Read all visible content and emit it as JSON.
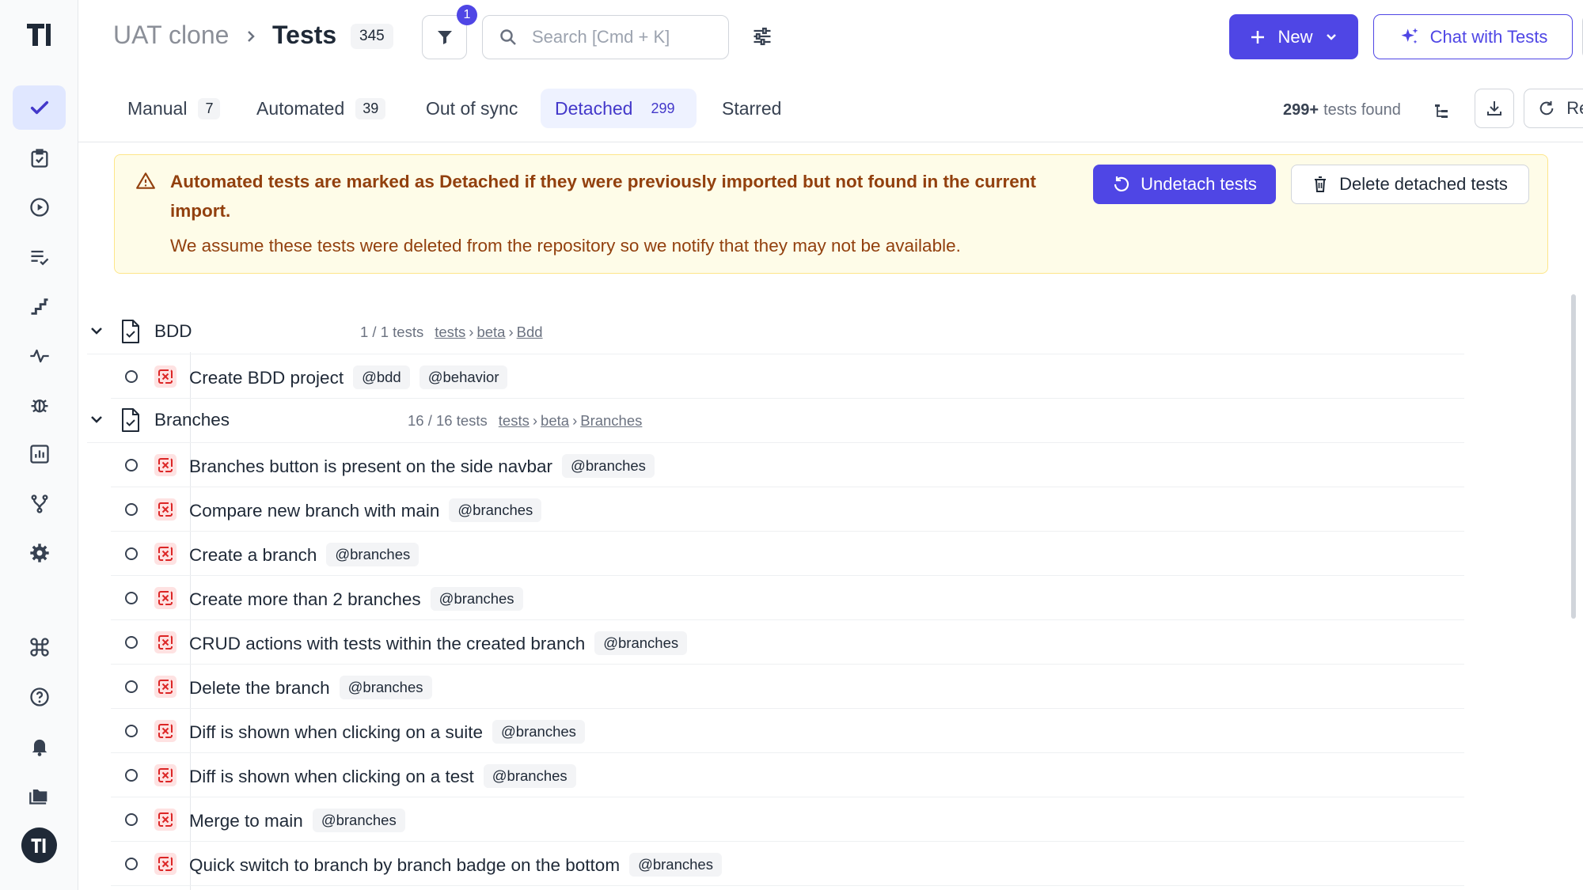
{
  "header": {
    "project": "UAT clone",
    "title": "Tests",
    "count": "345",
    "filter_count": "1",
    "search_placeholder": "Search [Cmd + K]",
    "new_label": "New",
    "chat_label": "Chat with Tests"
  },
  "tabs": [
    {
      "label": "Manual",
      "count": "7"
    },
    {
      "label": "Automated",
      "count": "39"
    },
    {
      "label": "Out of sync",
      "count": ""
    },
    {
      "label": "Detached",
      "count": "299"
    },
    {
      "label": "Starred",
      "count": ""
    }
  ],
  "toolbar": {
    "found_count": "299+",
    "found_label": "tests found",
    "reset_label": "Reset"
  },
  "banner": {
    "title": "Automated tests are marked as Detached if they were previously imported but not found in the current import.",
    "text": "We assume these tests were deleted from the repository so we notify that they may not be available.",
    "undetach_label": "Undetach tests",
    "delete_label": "Delete detached tests"
  },
  "suites": [
    {
      "name": "BDD",
      "count": "1 / 1 tests",
      "path": [
        "tests",
        "beta",
        "Bdd"
      ],
      "tests": [
        {
          "name": "Create BDD project",
          "tags": [
            "@bdd",
            "@behavior"
          ]
        }
      ]
    },
    {
      "name": "Branches",
      "count": "16 / 16 tests",
      "path": [
        "tests",
        "beta",
        "Branches"
      ],
      "tests": [
        {
          "name": "Branches button is present on the side navbar",
          "tags": [
            "@branches"
          ]
        },
        {
          "name": "Compare new branch with main",
          "tags": [
            "@branches"
          ]
        },
        {
          "name": "Create a branch",
          "tags": [
            "@branches"
          ]
        },
        {
          "name": "Create more than 2 branches",
          "tags": [
            "@branches"
          ]
        },
        {
          "name": "CRUD actions with tests within the created branch",
          "tags": [
            "@branches"
          ]
        },
        {
          "name": "Delete the branch",
          "tags": [
            "@branches"
          ]
        },
        {
          "name": "Diff is shown when clicking on a suite",
          "tags": [
            "@branches"
          ]
        },
        {
          "name": "Diff is shown when clicking on a test",
          "tags": [
            "@branches"
          ]
        },
        {
          "name": "Merge to main",
          "tags": [
            "@branches"
          ]
        },
        {
          "name": "Quick switch to branch by branch badge on the bottom",
          "tags": [
            "@branches"
          ]
        }
      ]
    }
  ],
  "colors": {
    "accent": "#4f46e5",
    "banner_bg": "#fefce8",
    "banner_text": "#92400e",
    "detached_icon": "#dc2626"
  }
}
